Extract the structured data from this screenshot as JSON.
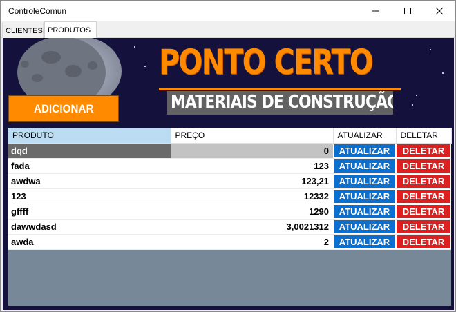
{
  "window": {
    "title": "ControleComun"
  },
  "tabs": [
    {
      "label": "CLIENTES",
      "active": false
    },
    {
      "label": "PRODUTOS",
      "active": true
    }
  ],
  "brand": {
    "title": "PONTO CERTO",
    "subtitle": "MATERIAIS DE CONSTRUÇÃO",
    "accent_color": "#ff8a00"
  },
  "actions": {
    "add_label": "ADICIONAR"
  },
  "table": {
    "columns": [
      "PRODUTO",
      "PREÇO",
      "ATUALIZAR",
      "DELETAR"
    ],
    "rows": [
      {
        "produto": "dqd",
        "preco": "0",
        "atualizar": "ATUALIZAR",
        "deletar": "DELETAR"
      },
      {
        "produto": "fada",
        "preco": "123",
        "atualizar": "ATUALIZAR",
        "deletar": "DELETAR"
      },
      {
        "produto": "awdwa",
        "preco": "123,21",
        "atualizar": "ATUALIZAR",
        "deletar": "DELETAR"
      },
      {
        "produto": "123",
        "preco": "12332",
        "atualizar": "ATUALIZAR",
        "deletar": "DELETAR"
      },
      {
        "produto": "gffff",
        "preco": "1290",
        "atualizar": "ATUALIZAR",
        "deletar": "DELETAR"
      },
      {
        "produto": "dawwdasd",
        "preco": "3,0021312",
        "atualizar": "ATUALIZAR",
        "deletar": "DELETAR"
      },
      {
        "produto": "awda",
        "preco": "2",
        "atualizar": "ATUALIZAR",
        "deletar": "DELETAR"
      }
    ]
  },
  "colors": {
    "background": "#14123d",
    "update_button": "#0a6fce",
    "delete_button": "#dc1f1f",
    "grid_empty": "#778899"
  },
  "icons": [
    "minimize-icon",
    "maximize-icon",
    "close-icon",
    "moon-icon"
  ]
}
